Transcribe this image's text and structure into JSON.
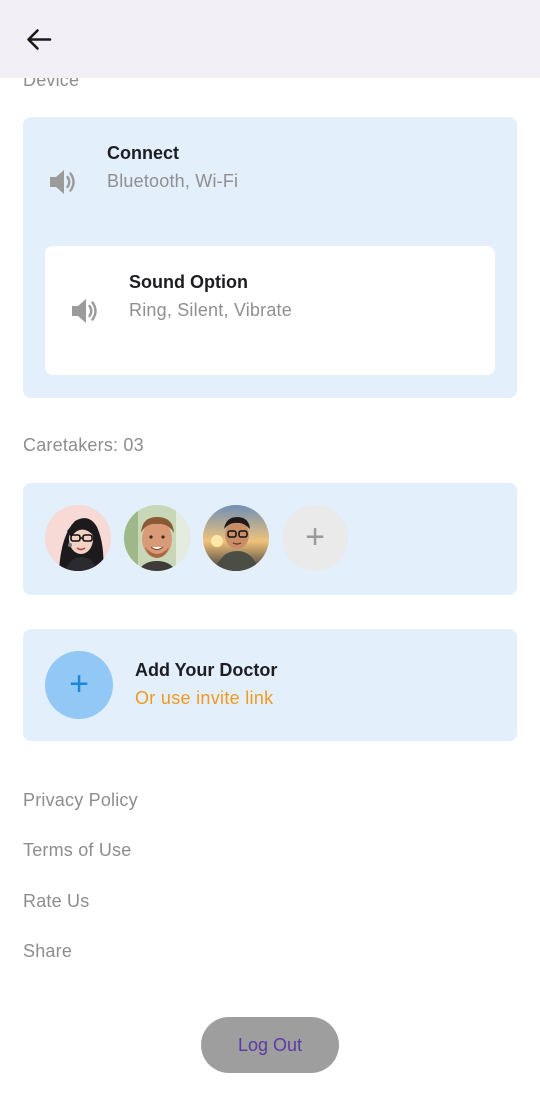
{
  "device_section": {
    "label": "Device"
  },
  "device_card": {
    "connect": {
      "title": "Connect",
      "subtitle": "Bluetooth, Wi-Fi",
      "icon": "speaker-icon"
    },
    "sound_option": {
      "title": "Sound Option",
      "subtitle": "Ring, Silent, Vibrate",
      "icon": "speaker-icon"
    }
  },
  "caretakers": {
    "label": "Caretakers: 03",
    "avatars": [
      "caretaker-avatar-1",
      "caretaker-avatar-2",
      "caretaker-avatar-3"
    ],
    "add_icon": "+"
  },
  "doctor": {
    "title": "Add Your Doctor",
    "link": "Or use invite link",
    "add_icon": "+"
  },
  "menu": {
    "items": [
      "Privacy Policy",
      "Terms of Use",
      "Rate Us",
      "Share"
    ]
  },
  "logout": {
    "label": "Log Out"
  },
  "colors": {
    "app_bar": "#f2eff6",
    "card_bg": "#e3effb",
    "link": "#ef9a1f",
    "logout_bg": "#9e9e9e",
    "logout_text": "#5b3aa6"
  }
}
